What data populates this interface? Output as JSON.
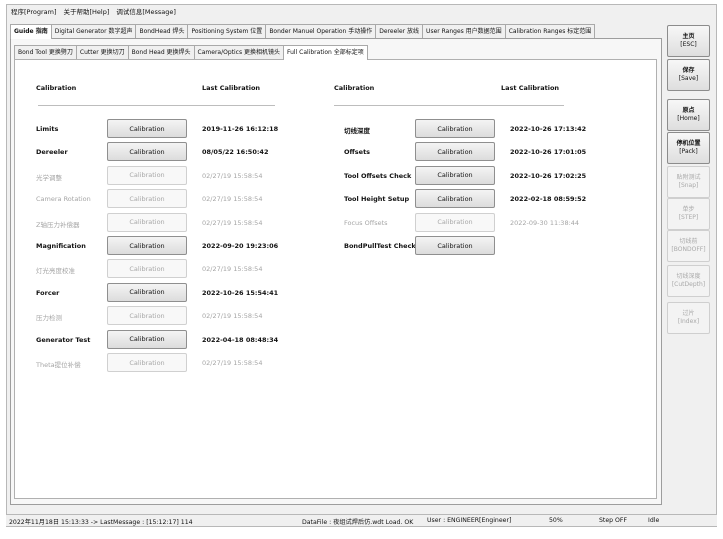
{
  "menu": [
    "程序[Program]",
    "关于帮助[Help]",
    "调试信息[Message]"
  ],
  "top_tabs": [
    {
      "label": "Guide 指南",
      "active": true
    },
    {
      "label": "Digital Generator 数字超声",
      "active": false
    },
    {
      "label": "BondHead 焊头",
      "active": false
    },
    {
      "label": "Positioning System 位置",
      "active": false
    },
    {
      "label": "Bonder Manuel Operation 手动操作",
      "active": false
    },
    {
      "label": "Dereeler 放线",
      "active": false
    },
    {
      "label": "User Ranges 用户数据范围",
      "active": false
    },
    {
      "label": "Calibration Ranges 标定范围",
      "active": false
    }
  ],
  "sub_tabs": [
    {
      "label": "Bond Tool 更换劈刀",
      "active": false
    },
    {
      "label": "Cutter 更换切刀",
      "active": false
    },
    {
      "label": "Bond Head 更换焊头",
      "active": false
    },
    {
      "label": "Camera/Optics 更换相机镜头",
      "active": false
    },
    {
      "label": "Full Calibration 全部标定项",
      "active": true
    }
  ],
  "columns": {
    "left_calibration": "Calibration",
    "left_last": "Last Calibration",
    "right_calibration": "Calibration",
    "right_last": "Last Calibration"
  },
  "button_label": "Calibration",
  "left_rows": [
    {
      "label": "Limits",
      "date": "2019-11-26 16:12:18",
      "enabled": true
    },
    {
      "label": "Dereeler",
      "date": "08/05/22 16:50:42",
      "enabled": true
    },
    {
      "label": "光学调整",
      "date": "02/27/19 15:58:54",
      "enabled": false
    },
    {
      "label": "Camera Rotation",
      "date": "02/27/19 15:58:54",
      "enabled": false
    },
    {
      "label": "Z轴压力补偿器",
      "date": "02/27/19 15:58:54",
      "enabled": false
    },
    {
      "label": "Magnification",
      "date": "2022-09-20 19:23:06",
      "enabled": true
    },
    {
      "label": "灯光亮度校准",
      "date": "02/27/19 15:58:54",
      "enabled": false
    },
    {
      "label": "Forcer",
      "date": "2022-10-26 15:54:41",
      "enabled": true
    },
    {
      "label": "压力检测",
      "date": "02/27/19 15:58:54",
      "enabled": false
    },
    {
      "label": "Generator Test",
      "date": "2022-04-18 08:48:34",
      "enabled": true
    },
    {
      "label": "Theta提位补偿",
      "date": "02/27/19 15:58:54",
      "enabled": false
    }
  ],
  "right_rows": [
    {
      "label": "切线深度",
      "date": "2022-10-26 17:13:42",
      "enabled": true
    },
    {
      "label": "Offsets",
      "date": "2022-10-26 17:01:05",
      "enabled": true
    },
    {
      "label": "Tool Offsets Check",
      "date": "2022-10-26 17:02:25",
      "enabled": true
    },
    {
      "label": "Tool Height Setup",
      "date": "2022-02-18 08:59:52",
      "enabled": true
    },
    {
      "label": "Focus Offsets",
      "date": "2022-09-30 11:38:44",
      "enabled": false
    },
    {
      "label": "BondPullTest Check",
      "date": "",
      "enabled": true
    }
  ],
  "sidebar": [
    {
      "main": "主页",
      "sub": "[ESC]",
      "enabled": true
    },
    {
      "main": "保存",
      "sub": "[Save]",
      "enabled": true
    },
    {
      "main": "原点",
      "sub": "[Home]",
      "enabled": true
    },
    {
      "main": "停机位置",
      "sub": "[Pack]",
      "enabled": true
    },
    {
      "main": "贴附测试",
      "sub": "[Snap]",
      "enabled": false
    },
    {
      "main": "单步",
      "sub": "[STEP]",
      "enabled": false
    },
    {
      "main": "切线前",
      "sub": "[BONDOFF]",
      "enabled": false
    },
    {
      "main": "切线深度",
      "sub": "[CutDepth]",
      "enabled": false
    },
    {
      "main": "过片",
      "sub": "[Index]",
      "enabled": false
    }
  ],
  "status": {
    "time_msg": "2022年11月18日 15:13:33 -> LastMessage : [15:12:17] 114",
    "datafile": "DataFile : 夜组试焊后仿.wdt Load. OK",
    "user": "User : ENGINEER[Engineer]",
    "percent": "50%",
    "step": "Step OFF",
    "state": "Idle"
  }
}
